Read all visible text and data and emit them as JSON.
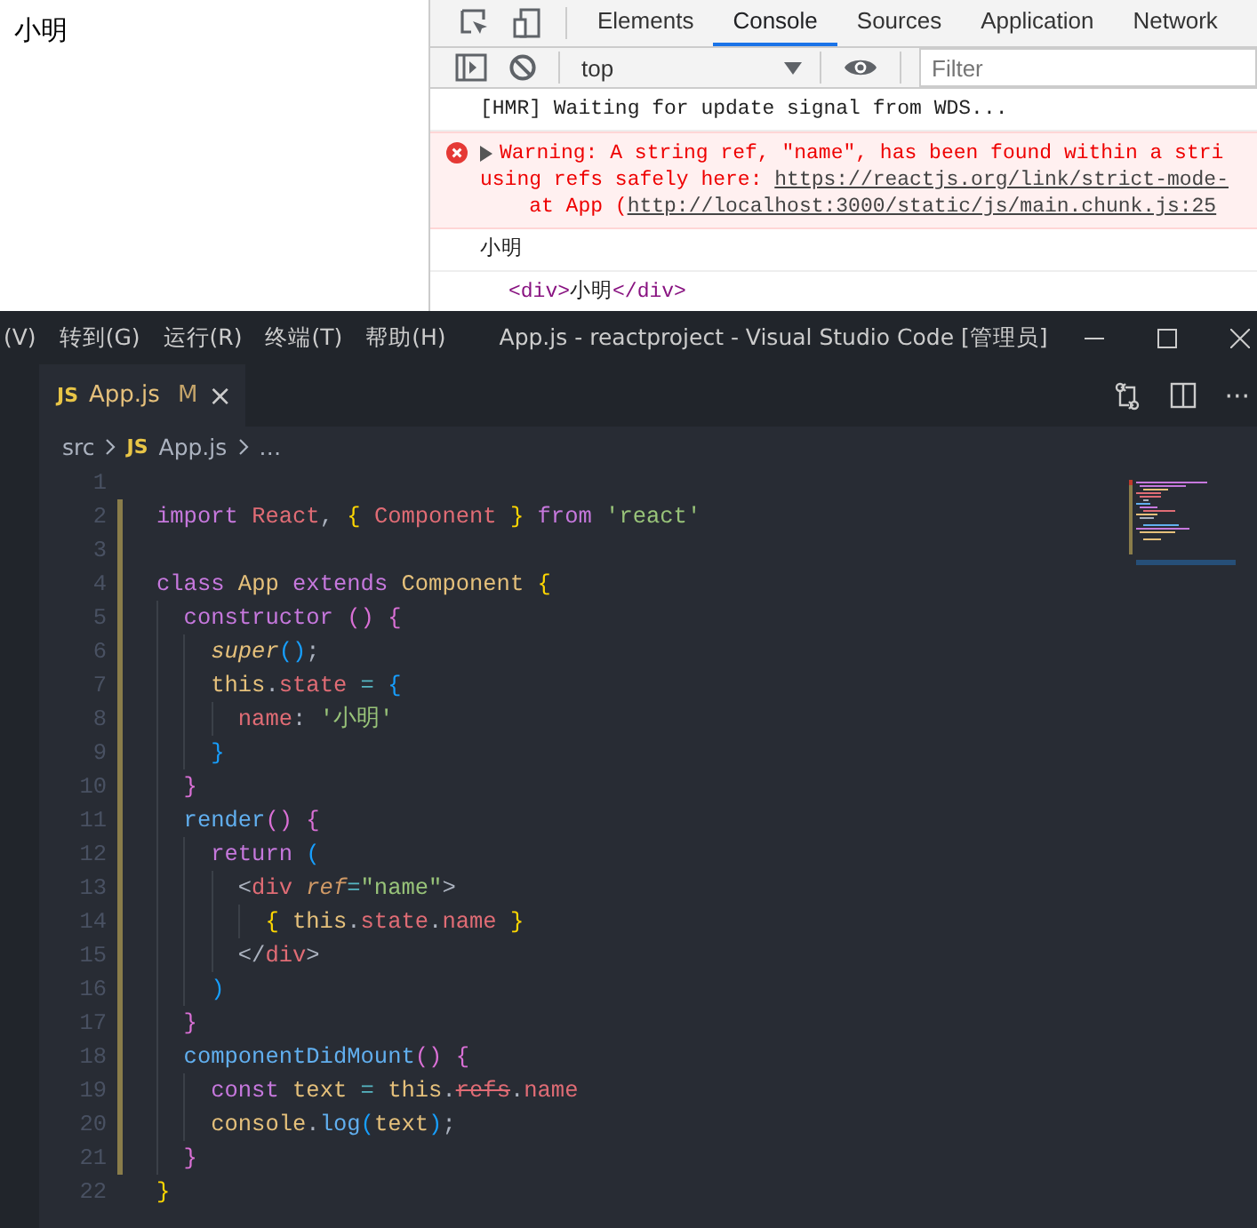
{
  "page": {
    "text": "小明"
  },
  "devtools": {
    "tabs": [
      {
        "label": "Elements",
        "selected": false
      },
      {
        "label": "Console",
        "selected": true
      },
      {
        "label": "Sources",
        "selected": false
      },
      {
        "label": "Application",
        "selected": false
      },
      {
        "label": "Network",
        "selected": false
      }
    ],
    "context": "top",
    "filter": {
      "placeholder": "Filter"
    },
    "messages": [
      {
        "kind": "log",
        "text": "[HMR] Waiting for update signal from WDS..."
      },
      {
        "kind": "warning",
        "lines": [
          {
            "text": "Warning: A string ref, \"name\", has been found within a stri"
          },
          {
            "text": "using refs safely here: ",
            "link": "https://reactjs.org/link/strict-mode-"
          },
          {
            "text": "    at App (",
            "link": "http://localhost:3000/static/js/main.chunk.js:25"
          }
        ]
      },
      {
        "kind": "log",
        "text": "小明"
      },
      {
        "kind": "element",
        "open": "<div>",
        "content": "小明",
        "close": "</div>"
      }
    ]
  },
  "vscode": {
    "menu": [
      "(V)",
      "转到(G)",
      "运行(R)",
      "终端(T)",
      "帮助(H)"
    ],
    "title": "App.js - reactproject - Visual Studio Code [管理员]",
    "tab": {
      "icon": "JS",
      "name": "App.js",
      "status": "M",
      "close": "×"
    },
    "more": "···",
    "breadcrumb": [
      "src",
      "JS",
      "App.js",
      "…"
    ],
    "lines": [
      {
        "number": "1",
        "modified": false
      },
      {
        "number": "2",
        "modified": true,
        "tokens": [
          {
            "text": "import ",
            "kind": "kw"
          },
          {
            "text": "React",
            "kind": "cls"
          },
          {
            "text": ", ",
            "kind": "plain"
          },
          {
            "text": "{",
            "kind": "b1"
          },
          {
            "text": " Component ",
            "kind": "cls"
          },
          {
            "text": "}",
            "kind": "b1"
          },
          {
            "text": " from ",
            "kind": "kw"
          },
          {
            "text": "'react'",
            "kind": "str"
          }
        ]
      },
      {
        "number": "3",
        "modified": true
      },
      {
        "number": "4",
        "modified": true,
        "tokens": [
          {
            "text": "class ",
            "kind": "kw"
          },
          {
            "text": "App ",
            "kind": "typ"
          },
          {
            "text": "extends ",
            "kind": "kw"
          },
          {
            "text": "Component ",
            "kind": "typ"
          },
          {
            "text": "{",
            "kind": "b1"
          }
        ]
      },
      {
        "number": "5",
        "modified": true,
        "tokens": [
          {
            "text": "  constructor ",
            "kind": "kw"
          },
          {
            "text": "()",
            "kind": "b2"
          },
          {
            "text": " {",
            "kind": "b2"
          }
        ]
      },
      {
        "number": "6",
        "modified": true,
        "tokens": [
          {
            "text": "    super",
            "kind": "ital"
          },
          {
            "text": "()",
            "kind": "b3"
          },
          {
            "text": ";",
            "kind": "plain"
          }
        ]
      },
      {
        "number": "7",
        "modified": true,
        "tokens": [
          {
            "text": "    this",
            "kind": "typ"
          },
          {
            "text": ".",
            "kind": "plain"
          },
          {
            "text": "state",
            "kind": "prop"
          },
          {
            "text": " = ",
            "kind": "op"
          },
          {
            "text": "{",
            "kind": "b3"
          }
        ]
      },
      {
        "number": "8",
        "modified": true,
        "tokens": [
          {
            "text": "      name",
            "kind": "prop"
          },
          {
            "text": ": ",
            "kind": "plain"
          },
          {
            "text": "'小明'",
            "kind": "str"
          }
        ]
      },
      {
        "number": "9",
        "modified": true,
        "tokens": [
          {
            "text": "    }",
            "kind": "b3"
          }
        ]
      },
      {
        "number": "10",
        "modified": true,
        "tokens": [
          {
            "text": "  }",
            "kind": "b2"
          }
        ]
      },
      {
        "number": "11",
        "modified": true,
        "tokens": [
          {
            "text": "  render",
            "kind": "fn"
          },
          {
            "text": "()",
            "kind": "b2"
          },
          {
            "text": " {",
            "kind": "b2"
          }
        ]
      },
      {
        "number": "12",
        "modified": true,
        "tokens": [
          {
            "text": "    return ",
            "kind": "kw"
          },
          {
            "text": "(",
            "kind": "b3"
          }
        ]
      },
      {
        "number": "13",
        "modified": true,
        "tokens": [
          {
            "text": "      <",
            "kind": "punct"
          },
          {
            "text": "div ",
            "kind": "tag"
          },
          {
            "text": "ref",
            "kind": "attr"
          },
          {
            "text": "=",
            "kind": "op"
          },
          {
            "text": "\"name\"",
            "kind": "str"
          },
          {
            "text": ">",
            "kind": "punct"
          }
        ]
      },
      {
        "number": "14",
        "modified": true,
        "tokens": [
          {
            "text": "        {",
            "kind": "b1"
          },
          {
            "text": " this",
            "kind": "typ"
          },
          {
            "text": ".",
            "kind": "plain"
          },
          {
            "text": "state",
            "kind": "prop"
          },
          {
            "text": ".",
            "kind": "plain"
          },
          {
            "text": "name ",
            "kind": "prop"
          },
          {
            "text": "}",
            "kind": "b1"
          }
        ]
      },
      {
        "number": "15",
        "modified": true,
        "tokens": [
          {
            "text": "      </",
            "kind": "punct"
          },
          {
            "text": "div",
            "kind": "tag"
          },
          {
            "text": ">",
            "kind": "punct"
          }
        ]
      },
      {
        "number": "16",
        "modified": true,
        "tokens": [
          {
            "text": "    )",
            "kind": "b3"
          }
        ]
      },
      {
        "number": "17",
        "modified": true,
        "tokens": [
          {
            "text": "  }",
            "kind": "b2"
          }
        ]
      },
      {
        "number": "18",
        "modified": true,
        "tokens": [
          {
            "text": "  componentDidMount",
            "kind": "fn"
          },
          {
            "text": "()",
            "kind": "b2"
          },
          {
            "text": " {",
            "kind": "b2"
          }
        ]
      },
      {
        "number": "19",
        "modified": true,
        "tokens": [
          {
            "text": "    const ",
            "kind": "kw"
          },
          {
            "text": "text",
            "kind": "typ"
          },
          {
            "text": " = ",
            "kind": "op"
          },
          {
            "text": "this",
            "kind": "typ"
          },
          {
            "text": ".",
            "kind": "plain"
          },
          {
            "text": "refs",
            "kind": "depr"
          },
          {
            "text": ".",
            "kind": "plain"
          },
          {
            "text": "name",
            "kind": "prop"
          }
        ]
      },
      {
        "number": "20",
        "modified": true,
        "tokens": [
          {
            "text": "    console",
            "kind": "typ"
          },
          {
            "text": ".",
            "kind": "plain"
          },
          {
            "text": "log",
            "kind": "fn"
          },
          {
            "text": "(",
            "kind": "b3"
          },
          {
            "text": "text",
            "kind": "typ"
          },
          {
            "text": ")",
            "kind": "b3"
          },
          {
            "text": ";",
            "kind": "plain"
          }
        ]
      },
      {
        "number": "21",
        "modified": true,
        "tokens": [
          {
            "text": "  }",
            "kind": "b2"
          }
        ]
      },
      {
        "number": "22",
        "modified": false,
        "tokens": [
          {
            "text": "}",
            "kind": "b1"
          }
        ]
      }
    ]
  }
}
